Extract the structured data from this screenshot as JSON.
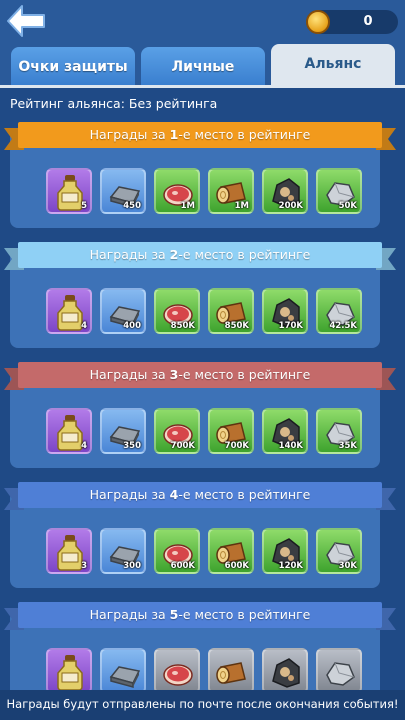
{
  "topbar": {
    "coins": "0"
  },
  "tabs": [
    {
      "label": "Очки защиты",
      "active": false
    },
    {
      "label": "Личные",
      "active": false
    },
    {
      "label": "Альянс",
      "active": true
    }
  ],
  "alliance_rank": "Рейтинг альянса: Без рейтинга",
  "reward_sections": [
    {
      "title_prefix": "Награды за ",
      "place": "1",
      "title_suffix": "-е место в рейтинге",
      "ribbon_color": "#f29a1c",
      "items": [
        {
          "icon": "potion-icon",
          "bg": "purple",
          "qty": "5"
        },
        {
          "icon": "iron-ingot-icon",
          "bg": "blue",
          "qty": "450"
        },
        {
          "icon": "meat-icon",
          "bg": "green",
          "qty": "1M"
        },
        {
          "icon": "wood-log-icon",
          "bg": "green",
          "qty": "1M"
        },
        {
          "icon": "coal-ore-icon",
          "bg": "green",
          "qty": "200K"
        },
        {
          "icon": "stone-icon",
          "bg": "green",
          "qty": "50K"
        }
      ]
    },
    {
      "title_prefix": "Награды за ",
      "place": "2",
      "title_suffix": "-е место в рейтинге",
      "ribbon_color": "#8fd0f5",
      "items": [
        {
          "icon": "potion-icon",
          "bg": "purple",
          "qty": "4"
        },
        {
          "icon": "iron-ingot-icon",
          "bg": "blue",
          "qty": "400"
        },
        {
          "icon": "meat-icon",
          "bg": "green",
          "qty": "850K"
        },
        {
          "icon": "wood-log-icon",
          "bg": "green",
          "qty": "850K"
        },
        {
          "icon": "coal-ore-icon",
          "bg": "green",
          "qty": "170K"
        },
        {
          "icon": "stone-icon",
          "bg": "green",
          "qty": "42.5K"
        }
      ]
    },
    {
      "title_prefix": "Награды за ",
      "place": "3",
      "title_suffix": "-е место в рейтинге",
      "ribbon_color": "#c46a6a",
      "items": [
        {
          "icon": "potion-icon",
          "bg": "purple",
          "qty": "4"
        },
        {
          "icon": "iron-ingot-icon",
          "bg": "blue",
          "qty": "350"
        },
        {
          "icon": "meat-icon",
          "bg": "green",
          "qty": "700K"
        },
        {
          "icon": "wood-log-icon",
          "bg": "green",
          "qty": "700K"
        },
        {
          "icon": "coal-ore-icon",
          "bg": "green",
          "qty": "140K"
        },
        {
          "icon": "stone-icon",
          "bg": "green",
          "qty": "35K"
        }
      ]
    },
    {
      "title_prefix": "Награды за ",
      "place": "4",
      "title_suffix": "-е место в рейтинге",
      "ribbon_color": "#4f7fd6",
      "items": [
        {
          "icon": "potion-icon",
          "bg": "purple",
          "qty": "3"
        },
        {
          "icon": "iron-ingot-icon",
          "bg": "blue",
          "qty": "300"
        },
        {
          "icon": "meat-icon",
          "bg": "green",
          "qty": "600K"
        },
        {
          "icon": "wood-log-icon",
          "bg": "green",
          "qty": "600K"
        },
        {
          "icon": "coal-ore-icon",
          "bg": "green",
          "qty": "120K"
        },
        {
          "icon": "stone-icon",
          "bg": "green",
          "qty": "30K"
        }
      ]
    },
    {
      "title_prefix": "Награды за ",
      "place": "5",
      "title_suffix": "-е место в рейтинге",
      "ribbon_color": "#4f7fd6",
      "items": [
        {
          "icon": "potion-icon",
          "bg": "purple",
          "qty": ""
        },
        {
          "icon": "iron-ingot-icon",
          "bg": "blue",
          "qty": ""
        },
        {
          "icon": "meat-icon",
          "bg": "gray",
          "qty": ""
        },
        {
          "icon": "wood-log-icon",
          "bg": "gray",
          "qty": ""
        },
        {
          "icon": "coal-ore-icon",
          "bg": "gray",
          "qty": ""
        },
        {
          "icon": "stone-icon",
          "bg": "gray",
          "qty": ""
        }
      ]
    }
  ],
  "footer_text": "Награды будут отправлены по почте после окончания события!"
}
